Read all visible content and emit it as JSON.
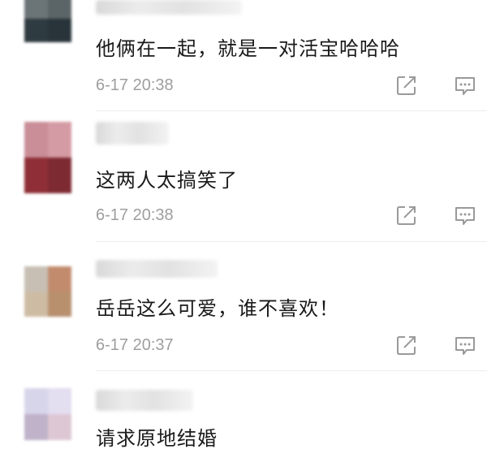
{
  "comments": [
    {
      "text": "他俩在一起，就是一对活宝哈哈哈",
      "time": "6-17 20:38",
      "avatar_colors": [
        "#6b7477",
        "#5b6466",
        "#2e3b40",
        "#28343a"
      ]
    },
    {
      "text": "这两人太搞笑了",
      "time": "6-17 20:38",
      "avatar_colors": [
        "#c98e97",
        "#d59ba4",
        "#8f2e36",
        "#7e2a33"
      ]
    },
    {
      "text": "岳岳这么可爱，谁不喜欢！",
      "time": "6-17 20:37",
      "avatar_colors": [
        "#c7bfb4",
        "#c28b6e",
        "#cdbca3",
        "#b8906e"
      ]
    },
    {
      "text": "请求原地结婚",
      "time": "",
      "avatar_colors": [
        "#d7d5ea",
        "#e3def0",
        "#bfb2c9",
        "#ddc7d4"
      ]
    }
  ],
  "icons": {
    "share": "share-icon",
    "reply": "comment-icon"
  }
}
